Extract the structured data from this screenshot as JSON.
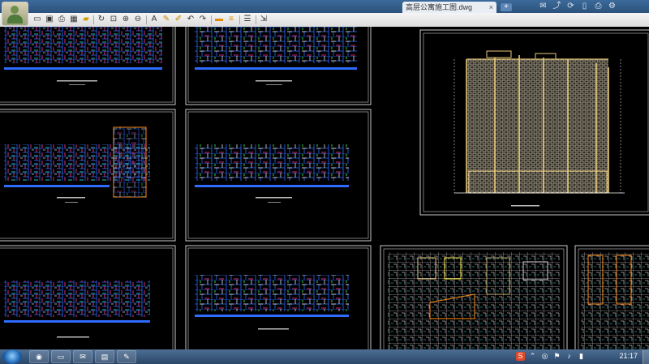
{
  "app": {
    "tab_title": "高层公寓施工图.dwg",
    "tab_close": "×",
    "new_tab": "+"
  },
  "toolbar": {
    "icons": [
      "open-icon",
      "save-icon",
      "print-icon",
      "image-icon",
      "lock-icon",
      "rotate-icon",
      "zoom-window-icon",
      "zoom-in-icon",
      "zoom-out-icon",
      "text-icon",
      "pen-icon",
      "marker-icon",
      "undo-icon",
      "redo-icon",
      "layer-icon",
      "color-icon",
      "layers-icon",
      "export-icon"
    ]
  },
  "system_icons": [
    "email-icon",
    "share-icon",
    "sync-icon",
    "mobile-icon",
    "print-icon",
    "settings-icon"
  ],
  "taskbar": {
    "clock": "21:17",
    "apps": [
      "chrome-icon",
      "folder-icon",
      "mail-icon",
      "winrar-icon",
      "drawing-icon"
    ],
    "tray": [
      "sogou-icon",
      "chevron-up-icon",
      "network-icon",
      "flag-icon",
      "volume-icon",
      "battery-icon"
    ]
  },
  "colors": {
    "background": "#000000",
    "sheet_border": "#c8c8c8",
    "plan_lines": [
      "#2e6bff",
      "#ff3aa8",
      "#2af0ff",
      "#ffffff",
      "#ffeb3b",
      "#39ff5a"
    ],
    "elevation": "#e6c77a"
  }
}
